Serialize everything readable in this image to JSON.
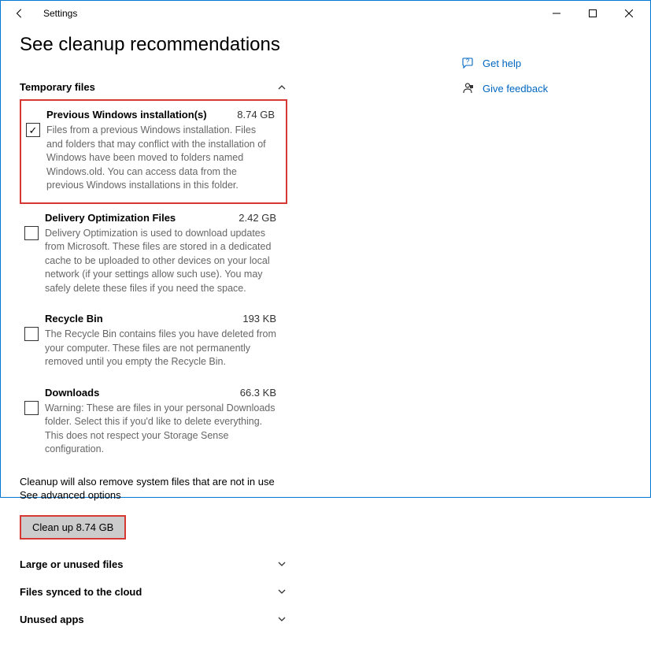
{
  "window": {
    "title": "Settings"
  },
  "page": {
    "title": "See cleanup recommendations"
  },
  "sections": {
    "temporary_files": {
      "label": "Temporary files",
      "expanded": true,
      "items": [
        {
          "title": "Previous Windows installation(s)",
          "size": "8.74 GB",
          "description": "Files from a previous Windows installation.  Files and folders that may conflict with the installation of Windows have been moved to folders named Windows.old.  You can access data from the previous Windows installations in this folder.",
          "checked": true
        },
        {
          "title": "Delivery Optimization Files",
          "size": "2.42 GB",
          "description": "Delivery Optimization is used to download updates from Microsoft. These files are stored in a dedicated cache to be uploaded to other devices on your local network (if your settings allow such use). You may safely delete these files if you need the space.",
          "checked": false
        },
        {
          "title": "Recycle Bin",
          "size": "193 KB",
          "description": "The Recycle Bin contains files you have deleted from your computer. These files are not permanently removed until you empty the Recycle Bin.",
          "checked": false
        },
        {
          "title": "Downloads",
          "size": "66.3 KB",
          "description": "Warning: These are files in your personal Downloads folder. Select this if you'd like to delete everything. This does not respect your Storage Sense configuration.",
          "checked": false
        }
      ]
    },
    "large_unused": {
      "label": "Large or unused files"
    },
    "synced_cloud": {
      "label": "Files synced to the cloud"
    },
    "unused_apps": {
      "label": "Unused apps"
    }
  },
  "notes": {
    "system_files": "Cleanup will also remove system files that are not in use",
    "advanced": "See advanced options"
  },
  "cleanup_button": "Clean up 8.74 GB",
  "side": {
    "help": "Get help",
    "feedback": "Give feedback"
  }
}
